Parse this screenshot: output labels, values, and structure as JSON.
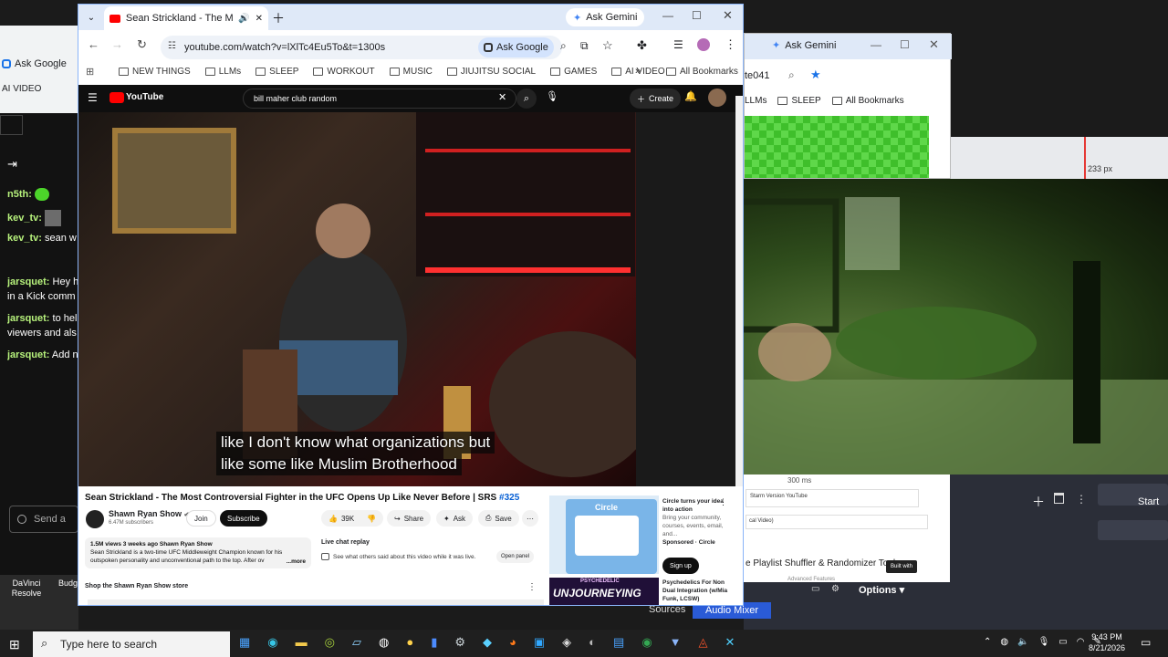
{
  "main_browser": {
    "tab_title": "Sean Strickland - The Most",
    "ask_gemini": "Ask Gemini",
    "url": "youtube.com/watch?v=lXlTc4Eu5To&t=1300s",
    "ask_google": "Ask Google",
    "bookmarks": [
      "NEW THINGS",
      "LLMs",
      "SLEEP",
      "WORKOUT",
      "MUSIC",
      "JIUJITSU SOCIAL",
      "GAMES",
      "AI VIDEO"
    ],
    "all_bookmarks": "All Bookmarks"
  },
  "youtube": {
    "logo": "YouTube",
    "search_value": "bill maher club random",
    "create_label": "Create",
    "caption_line1": "like I don't know what organizations but",
    "caption_line2": "like some like Muslim Brotherhood",
    "video_title": "Sean Strickland - The Most Controversial Fighter in the UFC Opens Up Like Never Before | SRS",
    "hashtag": "#325",
    "channel_name": "Shawn Ryan Show",
    "subscribers": "6.47M subscribers",
    "join_label": "Join",
    "subscribe_label": "Subscribe",
    "likes": "39K",
    "share_label": "Share",
    "ask_label": "Ask",
    "save_label": "Save",
    "views_line": "1.5M views  3 weeks ago  Shawn Ryan Show",
    "description": "Sean Strickland is a two-time UFC Middleweight Champion known for his outspoken personality and unconventional path to the top. After ov",
    "more_label": "...more",
    "live_chat_title": "Live chat replay",
    "live_chat_text": "See what others said about this video while it was live.",
    "open_panel": "Open panel",
    "store_label": "Shop the Shawn Ryan Show store",
    "ad_brand": "Circle",
    "ad_title": "Circle turns your idea into action",
    "ad_body": "Bring your community, courses, events, email, and...",
    "ad_sponsor": "Sponsored · Circle",
    "ad_button": "Sign up",
    "rec_thumb_text": "UNJOURNEYING",
    "rec_thumb_top": "PSYCHEDELIC",
    "rec_title": "Psychedelics For Non Dual Integration (w/Mia Funk, LCSW)"
  },
  "left_chat": {
    "ask_google": "Ask Google",
    "ai_video": "AI VIDEO",
    "messages": [
      {
        "user": "n5th:",
        "text": ""
      },
      {
        "user": "kev_tv:",
        "text": ""
      },
      {
        "user": "kev_tv:",
        "text": "sean w"
      },
      {
        "user": "jarsquet:",
        "text": "Hey h"
      },
      {
        "user": "",
        "text": "in a Kick comm"
      },
      {
        "user": "jarsquet:",
        "text": "to hel"
      },
      {
        "user": "",
        "text": "viewers and als"
      },
      {
        "user": "jarsquet:",
        "text": "Add n"
      }
    ],
    "send_placeholder": "Send a",
    "desk_1": "DaVinci Resolve",
    "desk_2": "Budg"
  },
  "right_browser": {
    "ask_gemini": "Ask Gemini",
    "url_fragment": "te041",
    "bookmarks": [
      "LLMs",
      "SLEEP"
    ],
    "all_bookmarks": "All Bookmarks",
    "measure": "233 px"
  },
  "right_obs": {
    "ms": "300 ms",
    "item1": "Starm Version YouTube",
    "item2": "cal Video)",
    "playlist_title": "e Playlist Shuffler & Randomizer Tool",
    "built_with": "Built with",
    "adv": "Advanced Features",
    "options": "Options",
    "sources": "Sources",
    "audio_mixer": "Audio Mixer",
    "start": "Start"
  },
  "taskbar": {
    "search_placeholder": "Type here to search",
    "time": "9:43 PM",
    "date": "8/21/2026"
  }
}
